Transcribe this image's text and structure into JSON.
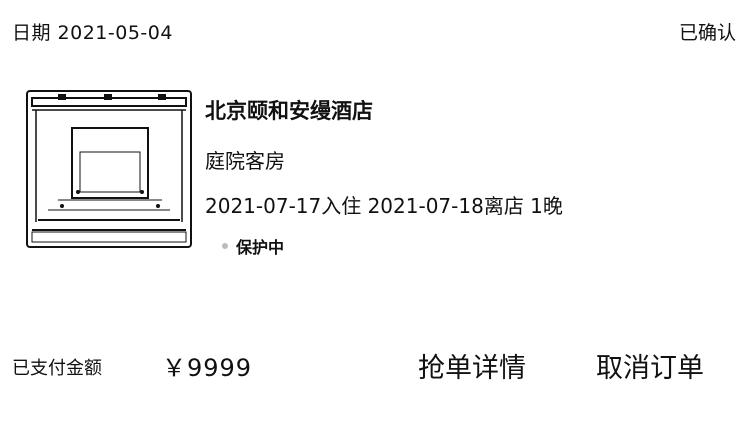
{
  "order": {
    "date_label": "日期 2021-05-04",
    "status": "已确认"
  },
  "hotel": {
    "name": "北京颐和安缦酒店",
    "room_type": "庭院客房",
    "stay_dates": "2021-07-17入住 2021-07-18离店 1晚",
    "protection": "保护中",
    "thumbnail_icon": "hotel-gate-image"
  },
  "payment": {
    "label": "已支付金额",
    "amount": "￥9999"
  },
  "actions": {
    "detail_label": "抢单详情",
    "cancel_label": "取消订单"
  }
}
